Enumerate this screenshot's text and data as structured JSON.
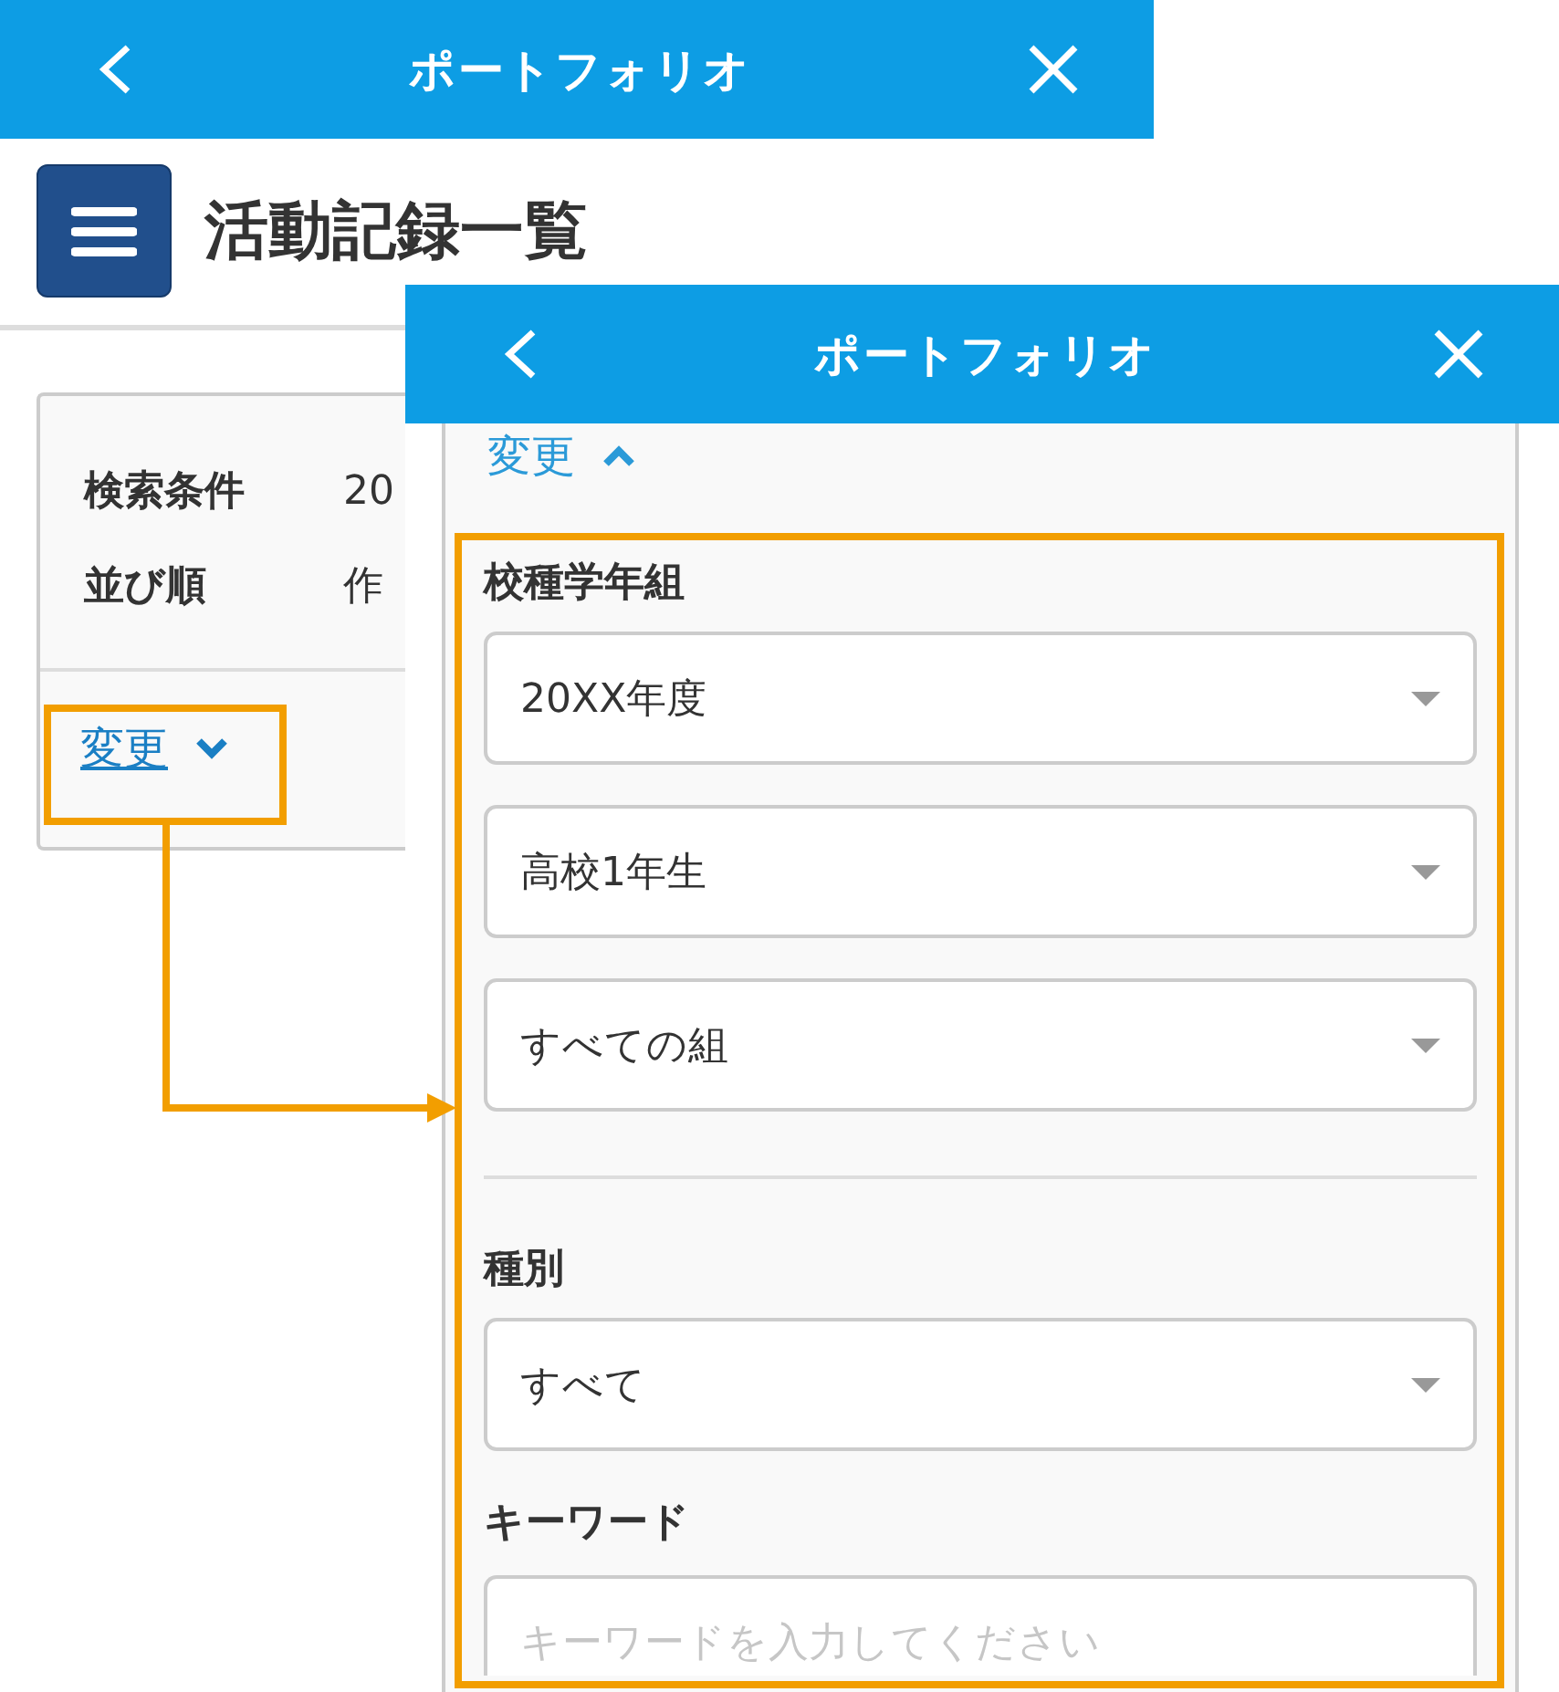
{
  "list_screen": {
    "header": {
      "title": "ポートフォリオ"
    },
    "page_title": "活動記録一覧",
    "conditions": [
      {
        "label": "検索条件",
        "value": "20"
      },
      {
        "label": "並び順",
        "value": "作"
      }
    ],
    "toggle": {
      "label": "変更",
      "expanded": false
    }
  },
  "filter_screen": {
    "header": {
      "title": "ポートフォリオ"
    },
    "toggle": {
      "label": "変更",
      "expanded": true
    },
    "sections": [
      {
        "label": "校種学年組",
        "divider_after": true,
        "fields": [
          {
            "kind": "select",
            "value": "20XX年度"
          },
          {
            "kind": "select",
            "value": "高校1年生"
          },
          {
            "kind": "select",
            "value": "すべての組"
          }
        ]
      },
      {
        "label": "種別",
        "divider_after": false,
        "fields": [
          {
            "kind": "select",
            "value": "すべて"
          }
        ]
      },
      {
        "label": "キーワード",
        "divider_after": false,
        "fields": [
          {
            "kind": "text",
            "placeholder": "キーワードを入力してください"
          }
        ]
      }
    ]
  }
}
